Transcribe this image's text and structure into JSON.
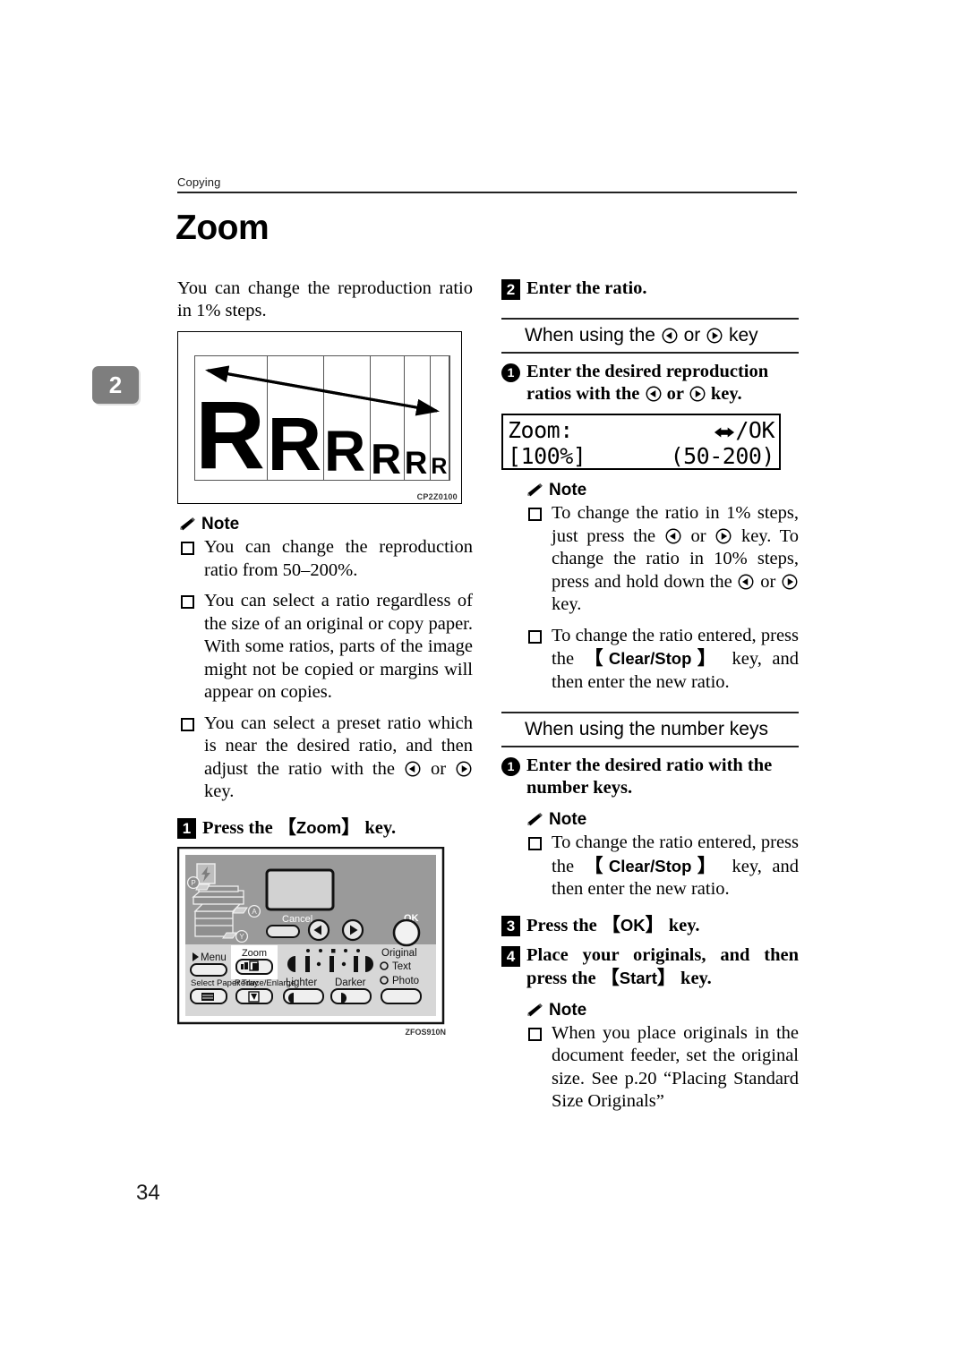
{
  "header": {
    "running_head": "Copying",
    "page_title": "Zoom",
    "chapter_tab": "2",
    "page_number": "34"
  },
  "left_column": {
    "intro": "You can change the reproduction ratio in 1% steps.",
    "figure": {
      "code": "CP2Z0100",
      "letters": [
        "R",
        "R",
        "R",
        "R",
        "R",
        "R"
      ],
      "alt": "Six letter R shapes decreasing in size with a diagonal arrow"
    },
    "note_label": "Note",
    "notes": [
      "You can change the reproduction ratio from 50–200%.",
      "You can select a ratio regardless of the size of an original or copy paper. With some ratios, parts of the image might not be copied or margins will appear on copies.",
      "You can select a preset ratio which is near the desired ratio, and then adjust the ratio with the ◁ or ▷ key."
    ],
    "note3_parts": {
      "before": "You can select a preset ratio which is near the desired ratio, and then adjust the ratio with the ",
      "middle": " or ",
      "after": " key."
    },
    "step1": {
      "number": "1",
      "text_before": "Press the ",
      "key": "Zoom",
      "text_after": " key."
    },
    "panel_figure": {
      "code": "ZFOS910N",
      "status_icons": [
        "P",
        "A",
        "Y"
      ],
      "buttons": [
        "Cancel",
        "OK",
        "Menu",
        "Zoom",
        "Select Paper Tray",
        "Reduce/Enlarge",
        "Lighter",
        "Darker"
      ],
      "original_label": "Original",
      "original_options": [
        "Text",
        "Photo"
      ]
    }
  },
  "right_column": {
    "step2": {
      "number": "2",
      "text": "Enter the ratio."
    },
    "subsection1": {
      "before": "When using the ",
      "middle": " or ",
      "after": " key"
    },
    "substep1": {
      "number": "1",
      "before": "Enter the desired reproduction ratios with the ",
      "middle": " or ",
      "after": " key."
    },
    "lcd": {
      "label": "Zoom:",
      "hint": "/OK",
      "value": "[100%]",
      "range": "(50-200)"
    },
    "note_label": "Note",
    "notes1": [
      {
        "p1": "To change the ratio in 1% steps, just press the ",
        "p2": " or ",
        "p3": " key. To change the ratio in 10% steps, press and hold down the ",
        "p4": " or ",
        "p5": " key."
      },
      {
        "p1": "To change the ratio entered, press the ",
        "key": "Clear/Stop",
        "p2": " key, and then enter the new ratio."
      }
    ],
    "subsection2": {
      "text": "When using the number keys"
    },
    "substep2": {
      "number": "1",
      "text": "Enter the desired ratio with the number keys."
    },
    "notes2": [
      {
        "p1": "To change the ratio entered, press the ",
        "key": "Clear/Stop",
        "p2": " key, and then enter the new ratio."
      }
    ],
    "step3": {
      "number": "3",
      "text_before": "Press the ",
      "key": "OK",
      "text_after": " key."
    },
    "step4": {
      "number": "4",
      "text_before": "Place your originals, and then press the ",
      "key": "Start",
      "text_after": " key."
    },
    "notes3": [
      "When you place originals in the document feeder, set the original size. See p.20 “Placing Standard Size Originals”"
    ]
  }
}
